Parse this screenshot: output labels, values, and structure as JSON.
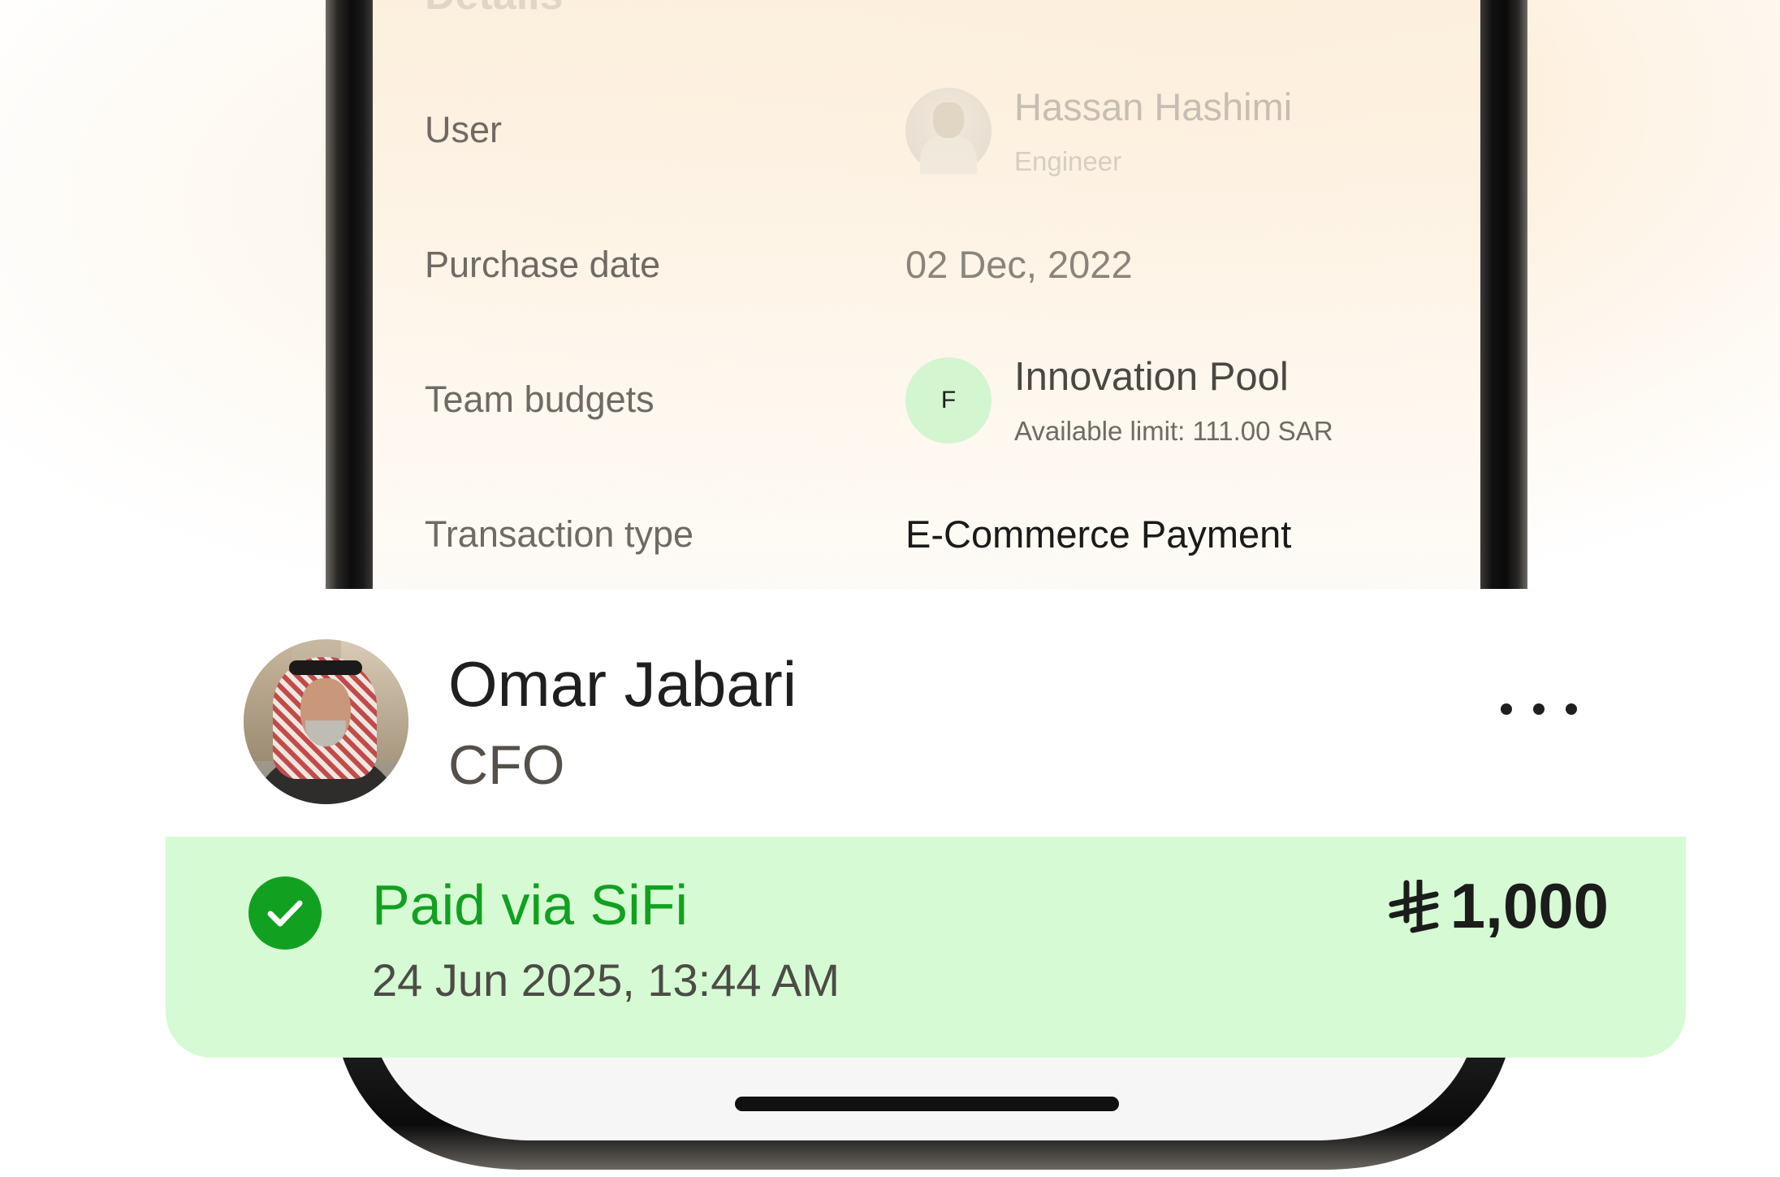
{
  "details": {
    "section_title": "Details",
    "rows": [
      {
        "label": "User"
      },
      {
        "label": "Purchase date",
        "value": "02 Dec, 2022"
      },
      {
        "label": "Team budgets"
      },
      {
        "label": "Transaction type",
        "value": "E-Commerce Payment"
      }
    ],
    "user": {
      "name": "Hassan Hashimi",
      "role": "Engineer"
    },
    "team": {
      "initial": "F",
      "name": "Innovation Pool",
      "limit": "Available limit: 111.00 SAR"
    }
  },
  "card": {
    "name": "Omar Jabari",
    "role": "CFO",
    "more_icon": "more-horizontal-icon"
  },
  "payment": {
    "status": "Paid via SiFi",
    "datetime": "24 Jun 2025, 13:44 AM",
    "currency_icon": "saudi-riyal-icon",
    "amount": "1,000",
    "status_color": "#12a020",
    "background_color": "#d6fbd4"
  }
}
